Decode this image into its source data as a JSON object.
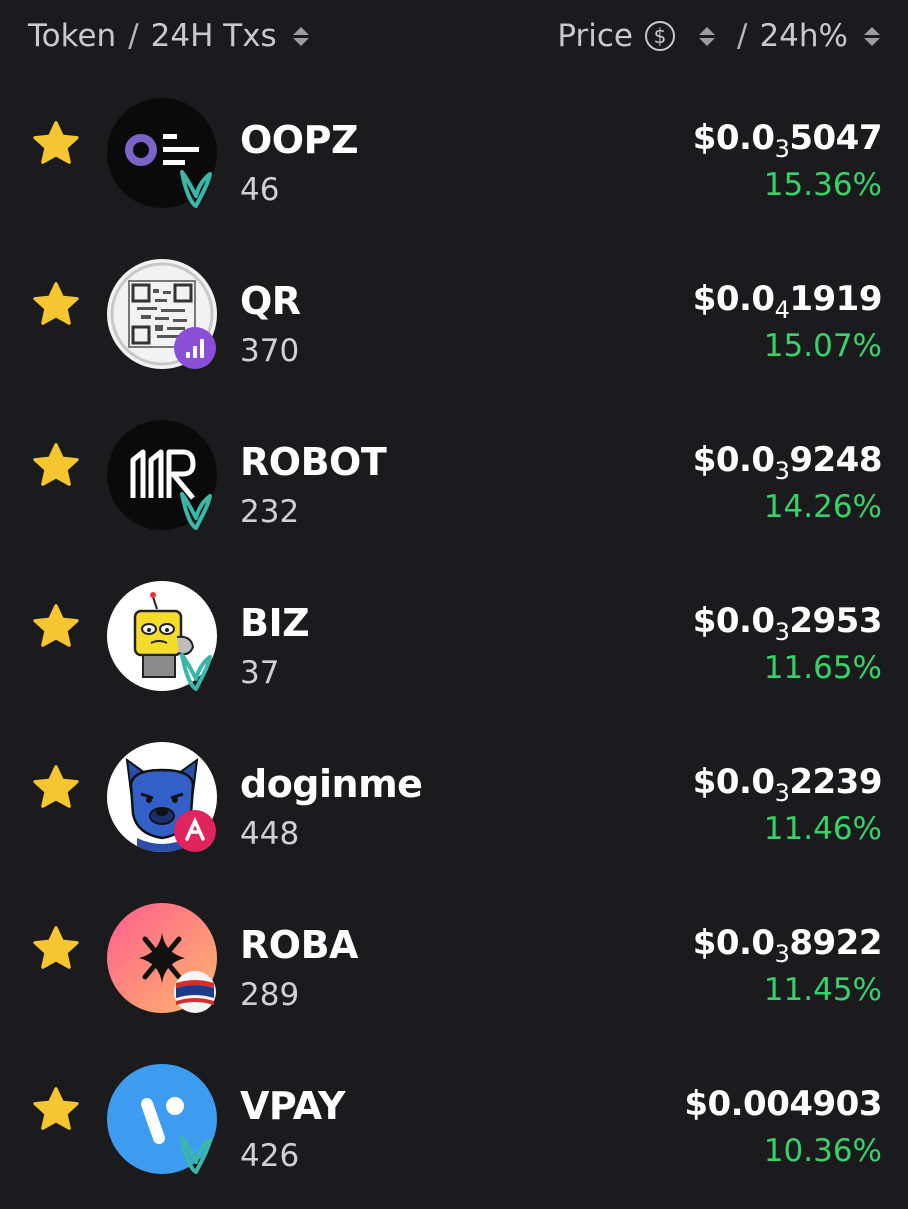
{
  "header": {
    "token_label": "Token",
    "separator": "/",
    "txs_label": "24H Txs",
    "price_label": "Price",
    "price_currency_symbol": "$",
    "change_label": "24h%"
  },
  "colors": {
    "background": "#1b1b1e",
    "positive": "#37d36a",
    "star": "#f6c631"
  },
  "tokens": [
    {
      "name": "OOPZ",
      "txs": "46",
      "price_prefix": "$0.0",
      "price_zeros": "3",
      "price_digits": "5047",
      "change": "15.36%",
      "badge": "leaf-badge-icon"
    },
    {
      "name": "QR",
      "txs": "370",
      "price_prefix": "$0.0",
      "price_zeros": "4",
      "price_digits": "1919",
      "change": "15.07%",
      "badge": "chart-badge-icon"
    },
    {
      "name": "ROBOT",
      "txs": "232",
      "price_prefix": "$0.0",
      "price_zeros": "3",
      "price_digits": "9248",
      "change": "14.26%",
      "badge": "leaf-badge-icon"
    },
    {
      "name": "BIZ",
      "txs": "37",
      "price_prefix": "$0.0",
      "price_zeros": "3",
      "price_digits": "2953",
      "change": "11.65%",
      "badge": "leaf-badge-icon"
    },
    {
      "name": "doginme",
      "txs": "448",
      "price_prefix": "$0.0",
      "price_zeros": "3",
      "price_digits": "2239",
      "change": "11.46%",
      "badge": "pink-badge-icon"
    },
    {
      "name": "ROBA",
      "txs": "289",
      "price_prefix": "$0.0",
      "price_zeros": "3",
      "price_digits": "8922",
      "change": "11.45%",
      "badge": "flag-badge-icon"
    },
    {
      "name": "VPAY",
      "txs": "426",
      "price_prefix": "$0.004903",
      "price_zeros": "",
      "price_digits": "",
      "change": "10.36%",
      "badge": "leaf-badge-icon"
    }
  ]
}
